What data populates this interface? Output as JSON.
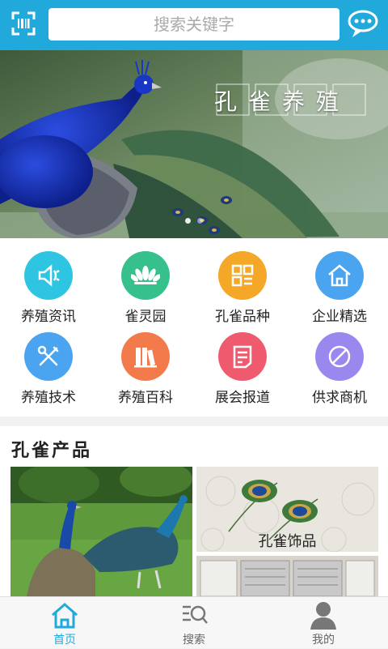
{
  "header": {
    "search_placeholder": "搜索关键字"
  },
  "banner": {
    "title": "孔雀养殖",
    "slides": 2,
    "active_slide": 1
  },
  "categories": [
    {
      "label": "养殖资讯",
      "icon": "speaker-icon",
      "color": "#2ec5e2"
    },
    {
      "label": "雀灵园",
      "icon": "lotus-icon",
      "color": "#35c08c"
    },
    {
      "label": "孔雀品种",
      "icon": "grid-list-icon",
      "color": "#f5a828"
    },
    {
      "label": "企业精选",
      "icon": "home-icon",
      "color": "#4aa4f0"
    },
    {
      "label": "养殖技术",
      "icon": "tools-icon",
      "color": "#4aa4f0"
    },
    {
      "label": "养殖百科",
      "icon": "books-icon",
      "color": "#f37a4a"
    },
    {
      "label": "展会报道",
      "icon": "document-icon",
      "color": "#f05a6e"
    },
    {
      "label": "供求商机",
      "icon": "no-entry-icon",
      "color": "#9a88ee"
    }
  ],
  "products": {
    "title": "孔雀产品",
    "items": [
      {
        "label": "孔雀饰品"
      }
    ]
  },
  "bottom_nav": {
    "items": [
      {
        "label": "首页",
        "active": true
      },
      {
        "label": "搜索",
        "active": false
      },
      {
        "label": "我的",
        "active": false
      }
    ]
  },
  "colors": {
    "primary": "#21a9dc"
  }
}
